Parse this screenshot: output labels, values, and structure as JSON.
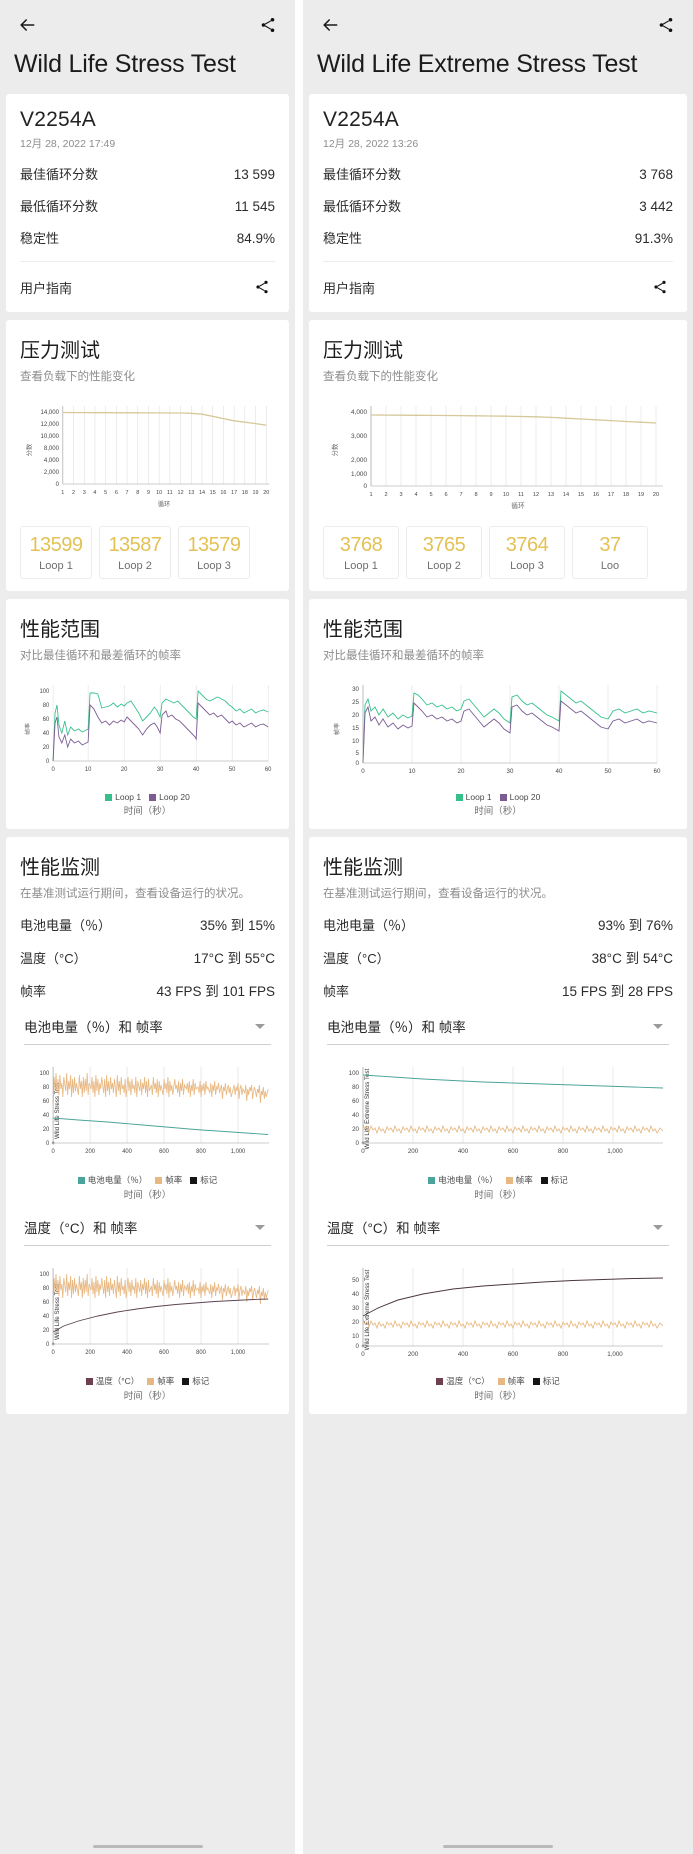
{
  "left": {
    "back_icon": "arrow-left-icon",
    "share_icon": "share-icon",
    "title": "Wild Life Stress Test",
    "device": "V2254A",
    "date": "12月 28, 2022 17:49",
    "rows": [
      {
        "label": "最佳循环分数",
        "value": "13 599"
      },
      {
        "label": "最低循环分数",
        "value": "11 545"
      },
      {
        "label": "稳定性",
        "value": "84.9%"
      }
    ],
    "guide_label": "用户指南",
    "stress": {
      "title": "压力测试",
      "subtitle": "查看负载下的性能变化",
      "loops": [
        {
          "score": "13599",
          "label": "Loop 1"
        },
        {
          "score": "13587",
          "label": "Loop 2"
        },
        {
          "score": "13579",
          "label": "Loop 3"
        }
      ]
    },
    "range": {
      "title": "性能范围",
      "subtitle": "对比最佳循环和最差循环的帧率",
      "legend": [
        "Loop 1",
        "Loop 20"
      ]
    },
    "monitor": {
      "title": "性能监测",
      "subtitle": "在基准测试运行期间，查看设备运行的状况。",
      "rows": [
        {
          "label": "电池电量（％）",
          "value": "35% 到 15%"
        },
        {
          "label": "温度（°C）",
          "value": "17°C 到 55°C"
        },
        {
          "label": "帧率",
          "value": "43 FPS 到 101 FPS"
        }
      ],
      "dropdown_1": "电池电量（％）和 帧率",
      "dropdown_2": "温度（°C）和 帧率",
      "chart1_ylabel": "Wild Life Stress Test",
      "chart2_ylabel": "Wild Life Stress Test",
      "legend_1": [
        "电池电量（％）",
        "帧率",
        "标记"
      ],
      "legend_2": [
        "温度（°C）",
        "帧率",
        "标记"
      ],
      "time_axis": "时间（秒）"
    }
  },
  "right": {
    "back_icon": "arrow-left-icon",
    "share_icon": "share-icon",
    "title": "Wild Life Extreme Stress Test",
    "device": "V2254A",
    "date": "12月 28, 2022 13:26",
    "rows": [
      {
        "label": "最佳循环分数",
        "value": "3 768"
      },
      {
        "label": "最低循环分数",
        "value": "3 442"
      },
      {
        "label": "稳定性",
        "value": "91.3%"
      }
    ],
    "guide_label": "用户指南",
    "stress": {
      "title": "压力测试",
      "subtitle": "查看负载下的性能变化",
      "loops": [
        {
          "score": "3768",
          "label": "Loop 1"
        },
        {
          "score": "3765",
          "label": "Loop 2"
        },
        {
          "score": "3764",
          "label": "Loop 3"
        },
        {
          "score": "37",
          "label": "Loo"
        }
      ]
    },
    "range": {
      "title": "性能范围",
      "subtitle": "对比最佳循环和最差循环的帧率",
      "legend": [
        "Loop 1",
        "Loop 20"
      ]
    },
    "monitor": {
      "title": "性能监测",
      "subtitle": "在基准测试运行期间，查看设备运行的状况。",
      "rows": [
        {
          "label": "电池电量（％）",
          "value": "93% 到 76%"
        },
        {
          "label": "温度（°C）",
          "value": "38°C 到 54°C"
        },
        {
          "label": "帧率",
          "value": "15 FPS 到 28 FPS"
        }
      ],
      "dropdown_1": "电池电量（％）和 帧率",
      "dropdown_2": "温度（°C）和 帧率",
      "chart1_ylabel": "Wild Life Extreme Stress Test",
      "chart2_ylabel": "Wild Life Extreme Stress Test",
      "legend_1": [
        "电池电量（％）",
        "帧率",
        "标记"
      ],
      "legend_2": [
        "温度（°C）",
        "帧率",
        "标记"
      ],
      "time_axis": "时间（秒）"
    }
  },
  "colors": {
    "loop_score": "#e3c154",
    "series_score": "#d6c89a",
    "loop1": "#35c08a",
    "loop20": "#7a5b92",
    "battery": "#4aa49a",
    "fps": "#e8b882",
    "temp": "#6b4050",
    "mark": "#151515"
  },
  "chart_data": [
    {
      "type": "line",
      "name": "left-stress-test",
      "title": "压力测试",
      "xlabel": "循环",
      "ylabel": "分数",
      "x": [
        1,
        2,
        3,
        4,
        5,
        6,
        7,
        8,
        9,
        10,
        11,
        12,
        13,
        14,
        15,
        16,
        17,
        18,
        19,
        20
      ],
      "xticks": [
        "1",
        "2",
        "3",
        "4",
        "5",
        "6",
        "7",
        "8",
        "9",
        "10",
        "11",
        "12",
        "13",
        "14",
        "15",
        "16",
        "17",
        "18",
        "19",
        "20"
      ],
      "yticks": [
        "0",
        "2,000",
        "4,000",
        "6,000",
        "8,000",
        "10,000",
        "12,000",
        "14,000"
      ],
      "ylim": [
        0,
        15000
      ],
      "values": [
        13599,
        13587,
        13579,
        13570,
        13565,
        13560,
        13558,
        13556,
        13552,
        13550,
        13548,
        13545,
        13540,
        13400,
        13050,
        12650,
        12300,
        12050,
        11800,
        11545
      ],
      "grid": true
    },
    {
      "type": "line",
      "name": "right-stress-test",
      "title": "压力测试",
      "xlabel": "循环",
      "ylabel": "分数",
      "x": [
        1,
        2,
        3,
        4,
        5,
        6,
        7,
        8,
        9,
        10,
        11,
        12,
        13,
        14,
        15,
        16,
        17,
        18,
        19,
        20
      ],
      "xticks": [
        "1",
        "2",
        "3",
        "4",
        "5",
        "6",
        "7",
        "8",
        "9",
        "10",
        "11",
        "12",
        "13",
        "14",
        "15",
        "16",
        "17",
        "18",
        "19",
        "20"
      ],
      "yticks": [
        "0",
        "1,000",
        "2,000",
        "3,000",
        "4,000"
      ],
      "ylim": [
        0,
        4300
      ],
      "values": [
        3768,
        3765,
        3764,
        3762,
        3760,
        3758,
        3756,
        3752,
        3748,
        3742,
        3735,
        3726,
        3700,
        3660,
        3620,
        3580,
        3540,
        3500,
        3470,
        3442
      ],
      "grid": true
    },
    {
      "type": "line",
      "name": "left-performance-range",
      "ylabel": "帧率",
      "xlabel": "时间（秒）",
      "xticks": [
        "0",
        "10",
        "20",
        "30",
        "40",
        "50",
        "60"
      ],
      "yticks": [
        "0",
        "20",
        "40",
        "60",
        "80",
        "100"
      ],
      "ylim": [
        0,
        110
      ],
      "xlim": [
        0,
        60
      ],
      "series": [
        {
          "name": "Loop 1",
          "color": "#35c08a"
        },
        {
          "name": "Loop 20",
          "color": "#7a5b92"
        }
      ]
    },
    {
      "type": "line",
      "name": "right-performance-range",
      "ylabel": "帧率",
      "xlabel": "时间（秒）",
      "xticks": [
        "0",
        "10",
        "20",
        "30",
        "40",
        "50",
        "60"
      ],
      "yticks": [
        "0",
        "5",
        "10",
        "15",
        "20",
        "25",
        "30"
      ],
      "ylim": [
        0,
        32
      ],
      "xlim": [
        0,
        60
      ],
      "series": [
        {
          "name": "Loop 1",
          "color": "#35c08a"
        },
        {
          "name": "Loop 20",
          "color": "#7a5b92"
        }
      ]
    },
    {
      "type": "line",
      "name": "left-battery-fps",
      "ylabel": "Wild Life Stress Test",
      "xlabel": "时间（秒）",
      "xticks": [
        "0",
        "200",
        "400",
        "600",
        "800",
        "1,000"
      ],
      "yticks": [
        "0",
        "20",
        "40",
        "60",
        "80",
        "100"
      ],
      "ylim": [
        0,
        110
      ],
      "xlim": [
        0,
        1180
      ],
      "series": [
        {
          "name": "电池电量（％）",
          "color": "#4aa49a",
          "start": 36,
          "end": 15
        },
        {
          "name": "帧率",
          "color": "#e8b882",
          "mean": 80,
          "amp": 18
        },
        {
          "name": "标记",
          "color": "#151515"
        }
      ]
    },
    {
      "type": "line",
      "name": "left-temp-fps",
      "ylabel": "Wild Life Stress Test",
      "xlabel": "时间（秒）",
      "xticks": [
        "0",
        "200",
        "400",
        "600",
        "800",
        "1,000"
      ],
      "yticks": [
        "0",
        "20",
        "40",
        "60",
        "80",
        "100"
      ],
      "ylim": [
        0,
        110
      ],
      "xlim": [
        0,
        1180
      ],
      "series": [
        {
          "name": "温度（°C）",
          "color": "#6b4050",
          "start": 17,
          "end": 55
        },
        {
          "name": "帧率",
          "color": "#e8b882",
          "mean": 80,
          "amp": 18
        },
        {
          "name": "标记",
          "color": "#151515"
        }
      ]
    },
    {
      "type": "line",
      "name": "right-battery-fps",
      "ylabel": "Wild Life Extreme Stress Test",
      "xlabel": "时间（秒）",
      "xticks": [
        "0",
        "200",
        "400",
        "600",
        "800",
        "1,000"
      ],
      "yticks": [
        "0",
        "20",
        "40",
        "60",
        "80",
        "100"
      ],
      "ylim": [
        0,
        110
      ],
      "xlim": [
        0,
        1180
      ],
      "series": [
        {
          "name": "电池电量（％）",
          "color": "#4aa49a",
          "start": 93,
          "end": 76
        },
        {
          "name": "帧率",
          "color": "#e8b882",
          "mean": 21,
          "amp": 7
        },
        {
          "name": "标记",
          "color": "#151515"
        }
      ]
    },
    {
      "type": "line",
      "name": "right-temp-fps",
      "ylabel": "Wild Life Extreme Stress Test",
      "xlabel": "时间（秒）",
      "xticks": [
        "0",
        "200",
        "400",
        "600",
        "800",
        "1,000"
      ],
      "yticks": [
        "0",
        "10",
        "20",
        "30",
        "40",
        "50"
      ],
      "ylim": [
        0,
        60
      ],
      "xlim": [
        0,
        1180
      ],
      "series": [
        {
          "name": "温度（°C）",
          "color": "#6b4050",
          "start": 38,
          "end": 54
        },
        {
          "name": "帧率",
          "color": "#e8b882",
          "mean": 21,
          "amp": 7
        },
        {
          "name": "标记",
          "color": "#151515"
        }
      ]
    }
  ]
}
